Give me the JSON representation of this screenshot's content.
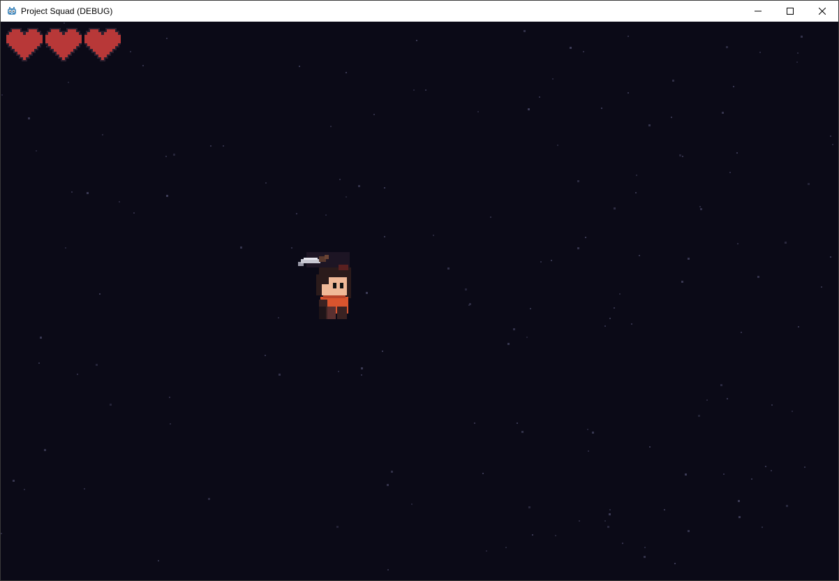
{
  "window": {
    "title": "Project Squad (DEBUG)",
    "app_icon": "godot-engine-icon",
    "controls": [
      "minimize",
      "maximize",
      "close"
    ]
  },
  "hud": {
    "hearts_total": 3,
    "hearts_full": 3,
    "heart_icon": "pixel-heart-icon"
  },
  "scene": {
    "background_color": "#0b0a17",
    "star_color": "#3c3b56",
    "player": {
      "description_icon": "player-character-sprite",
      "weapon_icon": "sword-icon"
    }
  },
  "colors": {
    "heart_fill": "#b83838",
    "heart_outline": "#2a1f2f",
    "player_shirt": "#d9542e",
    "player_skin": "#f0b998",
    "player_hair": "#2b1b1b"
  }
}
